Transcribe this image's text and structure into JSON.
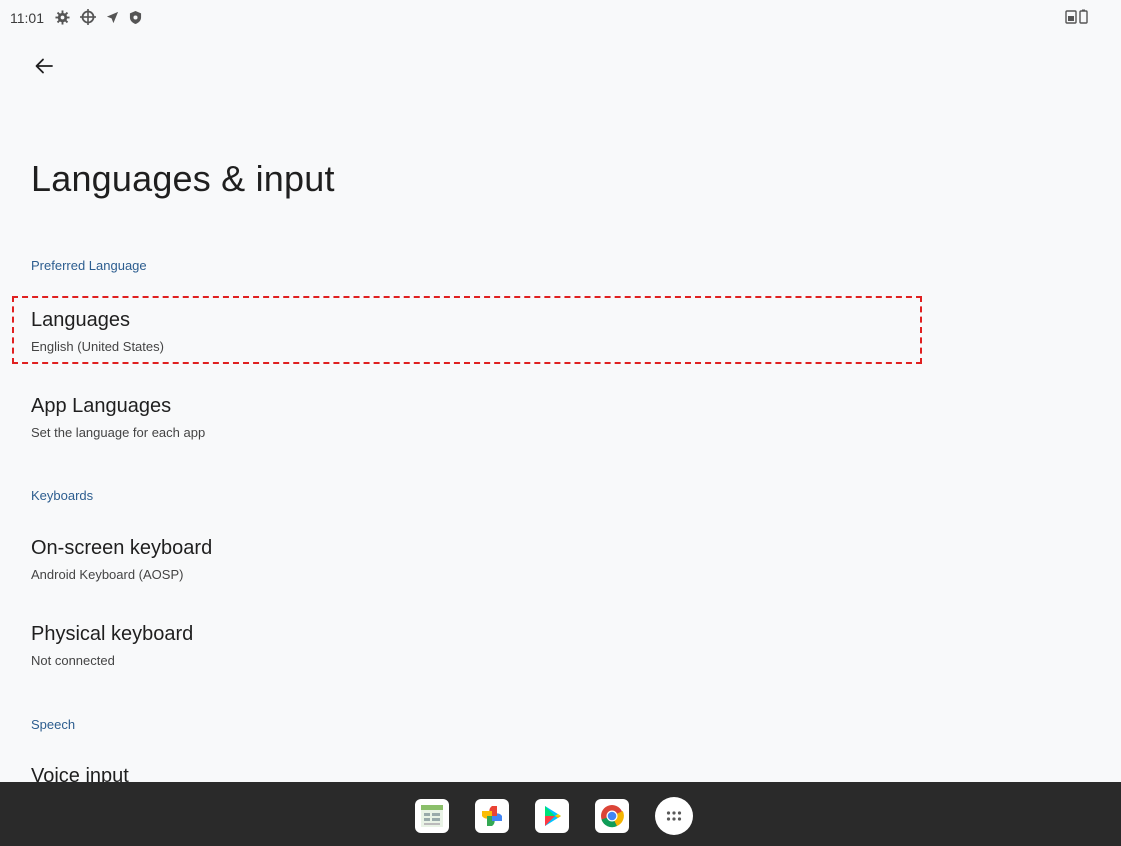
{
  "status_bar": {
    "time": "11:01",
    "icons": [
      "gear-icon",
      "crosshair-icon",
      "location-arrow-icon",
      "shield-icon"
    ],
    "right_icons": [
      "sim-card-icon",
      "battery-icon"
    ]
  },
  "toolbar": {
    "back_icon": "arrow-left-icon"
  },
  "page": {
    "title": "Languages & input"
  },
  "sections": [
    {
      "header": "Preferred Language",
      "items": [
        {
          "title": "Languages",
          "subtitle": "English (United States)"
        },
        {
          "title": "App Languages",
          "subtitle": "Set the language for each app"
        }
      ]
    },
    {
      "header": "Keyboards",
      "items": [
        {
          "title": "On-screen keyboard",
          "subtitle": "Android Keyboard (AOSP)"
        },
        {
          "title": "Physical keyboard",
          "subtitle": "Not connected"
        }
      ]
    },
    {
      "header": "Speech",
      "items": [
        {
          "title": "Voice input",
          "subtitle": ""
        }
      ]
    }
  ],
  "taskbar": {
    "apps": [
      "sheets-app-icon",
      "photos-app-icon",
      "play-store-icon",
      "chrome-icon",
      "app-drawer-icon"
    ]
  },
  "colors": {
    "background": "#f8f9fa",
    "section_header": "#2c5d8f",
    "highlight": "#e02020",
    "taskbar": "#2a2a2a"
  }
}
